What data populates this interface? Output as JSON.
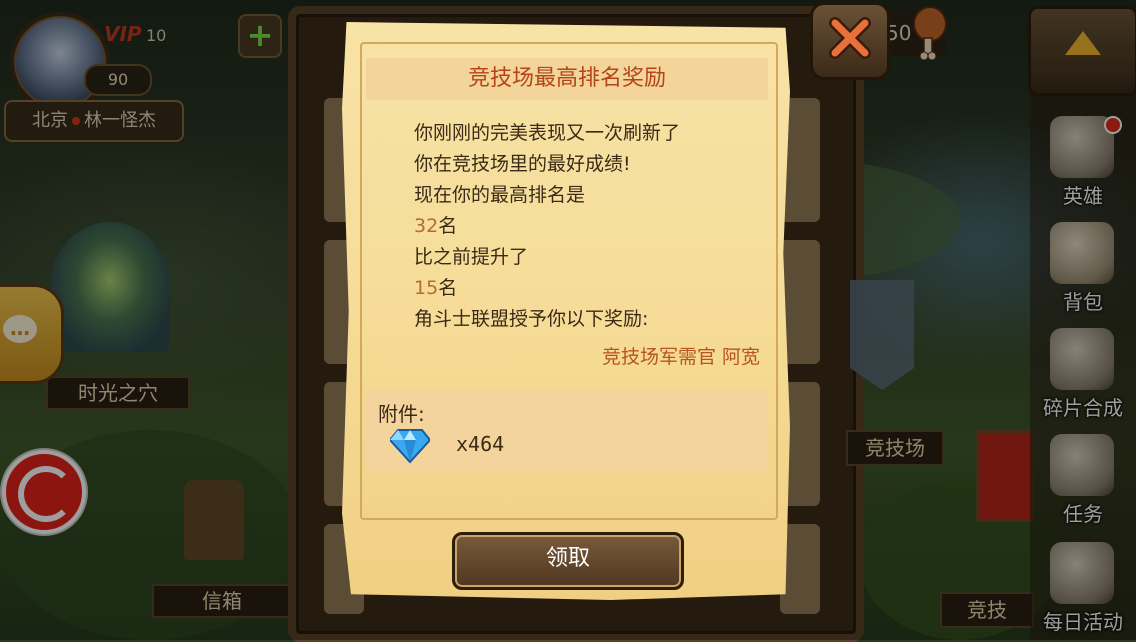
{
  "hud": {
    "vip_label": "VIP",
    "vip_level": "10",
    "player_level": "90",
    "player_location": "北京",
    "player_name": "林一怪杰",
    "currency_partial": "50"
  },
  "left_panel": {
    "time_cave_label": "时光之穴",
    "mailbox_label": "信箱"
  },
  "right_menu": {
    "items": [
      {
        "label": "英雄",
        "icon": "helmet-icon",
        "badge": true
      },
      {
        "label": "背包",
        "icon": "backpack-icon",
        "badge": false
      },
      {
        "label": "碎片合成",
        "icon": "puzzle-icon",
        "badge": false
      },
      {
        "label": "任务",
        "icon": "scroll-quill-icon",
        "badge": false
      },
      {
        "label": "每日活动",
        "icon": "gift-icon",
        "badge": false
      }
    ],
    "arena_label": "竞技场",
    "arena_label_partial": "竞技"
  },
  "modal": {
    "title": "竞技场最高排名奖励",
    "message_lines": [
      "你刚刚的完美表现又一次刷新了",
      "你在竞技场里的最好成绩!",
      "现在你的最高排名是"
    ],
    "best_rank_number": "32",
    "rank_unit": "名",
    "improved_text": "比之前提升了",
    "improved_number": "15",
    "reward_intro": "角斗士联盟授予你以下奖励:",
    "signature": "竞技场军需官  阿宽",
    "attachment_label": "附件:",
    "attachment_item_icon": "diamond-icon",
    "attachment_quantity": "x464",
    "claim_button": "领取"
  },
  "colors": {
    "title_text": "#b54418",
    "number_highlight": "#b86b30",
    "signature_text": "#b8541c",
    "parchment": "#f6dc98",
    "gem": "#3aa8f0"
  }
}
